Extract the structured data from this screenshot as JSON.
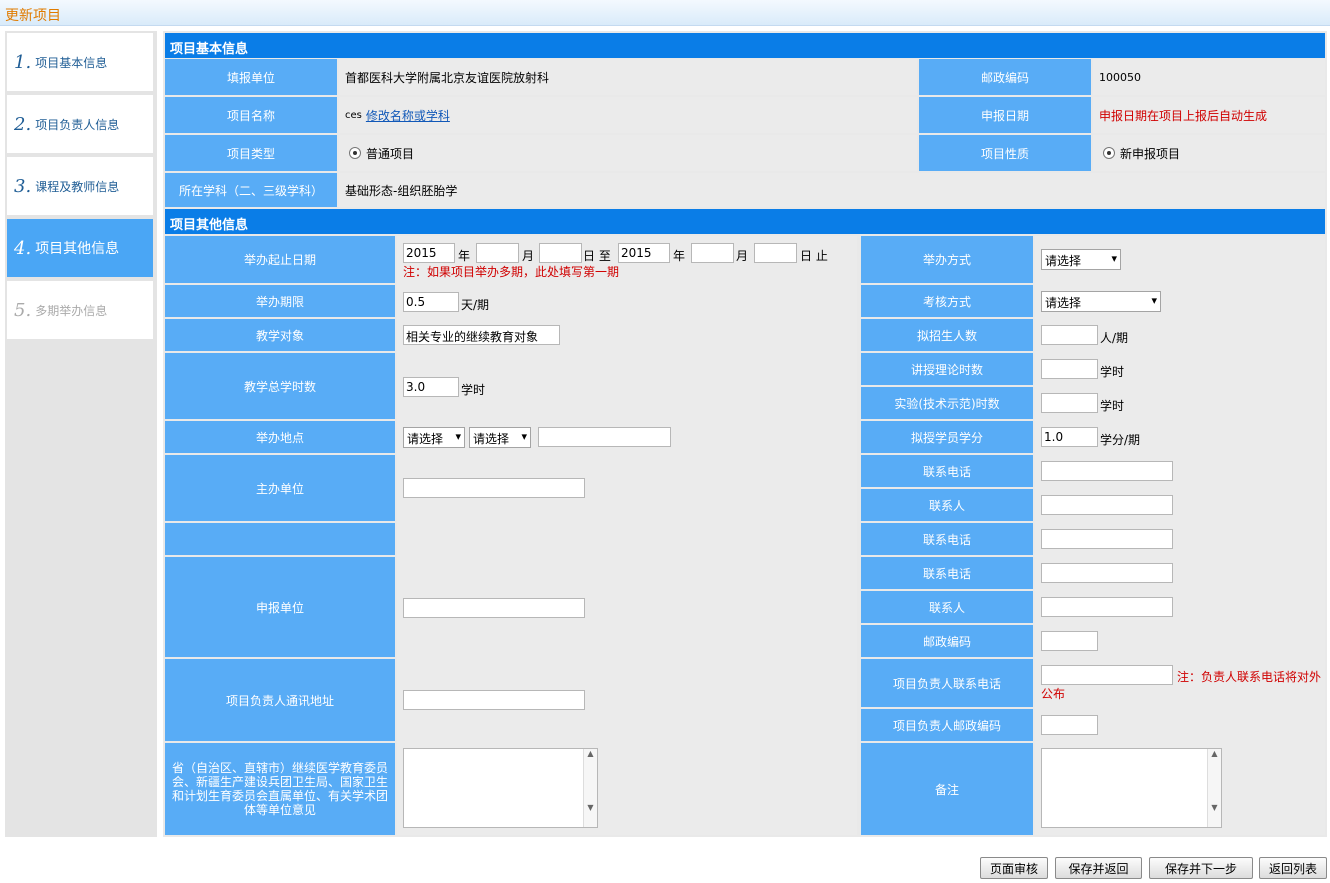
{
  "window": {
    "title": "更新项目"
  },
  "steps": [
    {
      "num": "1.",
      "label": "项目基本信息"
    },
    {
      "num": "2.",
      "label": "项目负责人信息"
    },
    {
      "num": "3.",
      "label": "课程及教师信息"
    },
    {
      "num": "4.",
      "label": "项目其他信息"
    },
    {
      "num": "5.",
      "label": "多期举办信息"
    }
  ],
  "basic": {
    "header": "项目基本信息",
    "unit_label": "填报单位",
    "unit_value": "首都医科大学附属北京友谊医院放射科",
    "postcode_label": "邮政编码",
    "postcode_value": "100050",
    "name_label": "项目名称",
    "name_value": "ces",
    "name_link": "修改名称或学科",
    "date_label": "申报日期",
    "date_value": "申报日期在项目上报后自动生成",
    "type_label": "项目类型",
    "type_value": "普通项目",
    "nature_label": "项目性质",
    "nature_value": "新申报项目",
    "subject_label": "所在学科（二、三级学科）",
    "subject_value": "基础形态-组织胚胎学"
  },
  "other": {
    "header": "项目其他信息",
    "dates_label": "举办起止日期",
    "start_year": "2015",
    "end_year": "2015",
    "year": "年",
    "month": "月",
    "day_to": "日 至",
    "day_end": "日 止",
    "dates_note": "注：如果项目举办多期，此处填写第一期",
    "method_label": "举办方式",
    "method_value": "请选择",
    "duration_label": "举办期限",
    "duration_value": "0.5",
    "duration_unit": "天/期",
    "exam_label": "考核方式",
    "exam_value": "请选择",
    "target_label": "教学对象",
    "target_value": "相关专业的继续教育对象",
    "enroll_label": "拟招生人数",
    "enroll_unit": "人/期",
    "hours_label": "教学总学时数",
    "hours_value": "3.0",
    "hours_unit": "学时",
    "theory_label": "讲授理论时数",
    "theory_unit": "学时",
    "exp_label": "实验(技术示范)时数",
    "exp_unit": "学时",
    "place_label": "举办地点",
    "place_sel1": "请选择",
    "place_sel2": "请选择",
    "credit_label": "拟授学员学分",
    "credit_value": "1.0",
    "credit_unit": "学分/期",
    "host_label": "主办单位",
    "phone_label": "联系电话",
    "contact_label": "联系人",
    "apply_label": "申报单位",
    "postcode_label": "邮政编码",
    "addr_label": "项目负责人通讯地址",
    "leader_phone_label": "项目负责人联系电话",
    "leader_phone_note": "注：负责人联系电话将对外公布",
    "leader_post_label": "项目负责人邮政编码",
    "opinion_label": "省（自治区、直辖市）继续医学教育委员会、新疆生产建设兵团卫生局、国家卫生和计划生育委员会直属单位、有关学术团体等单位意见",
    "remark_label": "备注"
  },
  "buttons": {
    "review": "页面审核",
    "save_back": "保存并返回",
    "save_next": "保存并下一步",
    "back_list": "返回列表"
  }
}
